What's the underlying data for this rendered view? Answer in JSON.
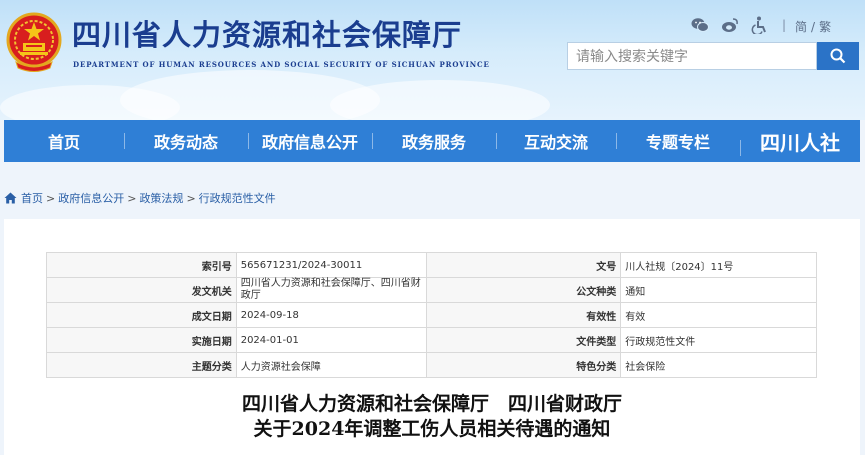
{
  "header": {
    "title": "四川省人力资源和社会保障厅",
    "subtitle": "DEPARTMENT OF HUMAN RESOURCES AND SOCIAL SECURITY OF SICHUAN PROVINCE",
    "social_icons": [
      "wechat-icon",
      "weibo-icon",
      "accessibility-icon"
    ],
    "lang_simplified": "简",
    "lang_sep": "/",
    "lang_traditional": "繁",
    "divider": "|",
    "search_placeholder": "请输入搜索关键字"
  },
  "nav": {
    "items": [
      "首页",
      "政务动态",
      "政府信息公开",
      "政务服务",
      "互动交流",
      "专题专栏"
    ],
    "logo_text": "四川人社"
  },
  "breadcrumb": [
    "首页",
    "政府信息公开",
    "政策法规",
    "行政规范性文件"
  ],
  "meta": {
    "rows": [
      {
        "k1": "索引号",
        "v1": "565671231/2024-30011",
        "k2": "文号",
        "v2": "川人社规〔2024〕11号"
      },
      {
        "k1": "发文机关",
        "v1": "四川省人力资源和社会保障厅、四川省财政厅",
        "k2": "公文种类",
        "v2": "通知"
      },
      {
        "k1": "成文日期",
        "v1": "2024-09-18",
        "k2": "有效性",
        "v2": "有效"
      },
      {
        "k1": "实施日期",
        "v1": "2024-01-01",
        "k2": "文件类型",
        "v2": "行政规范性文件"
      },
      {
        "k1": "主题分类",
        "v1": "人力资源社会保障",
        "k2": "特色分类",
        "v2": "社会保险"
      }
    ]
  },
  "document": {
    "title_line1": "四川省人力资源和社会保障厅　四川省财政厅",
    "title_line2": "关于2024年调整工伤人员相关待遇的通知"
  }
}
